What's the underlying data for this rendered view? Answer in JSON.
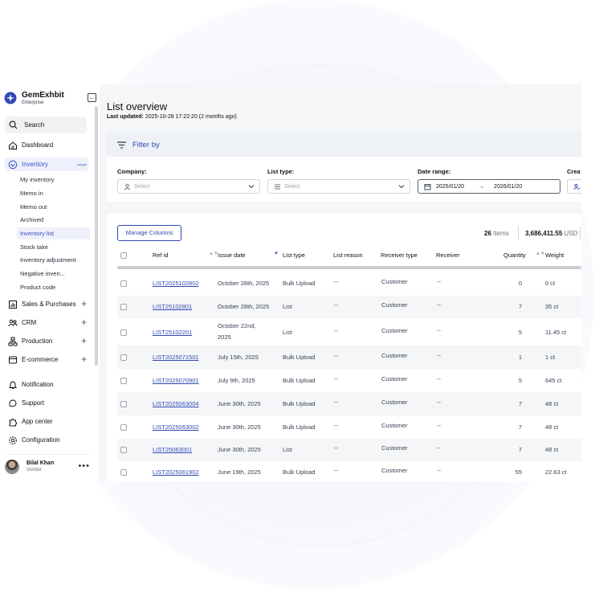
{
  "brand": {
    "name": "GemExhbit",
    "subtitle": "Enterprise"
  },
  "sidebar": {
    "search_label": "Search",
    "items": [
      {
        "label": "Dashboard",
        "icon": "home-icon"
      },
      {
        "label": "Inventory",
        "icon": "inventory-icon",
        "expanded": true
      },
      {
        "label": "Sales & Purchases",
        "icon": "chart-icon"
      },
      {
        "label": "CRM",
        "icon": "people-icon"
      },
      {
        "label": "Production",
        "icon": "production-icon"
      },
      {
        "label": "E-commerce",
        "icon": "cart-icon"
      },
      {
        "label": "Notification",
        "icon": "bell-icon"
      },
      {
        "label": "Support",
        "icon": "support-icon"
      },
      {
        "label": "App center",
        "icon": "puzzle-icon"
      },
      {
        "label": "Configuration",
        "icon": "gear-icon"
      }
    ],
    "inventory_sub": [
      "My inventory",
      "Memo in",
      "Memo out",
      "Archived",
      "Inventory list",
      "Stock take",
      "Inventory adjustment",
      "Negative inven...",
      "Product code"
    ],
    "active_sub": "Inventory list",
    "user": {
      "name": "Bilal Khan",
      "role": "Vendor"
    }
  },
  "main": {
    "title": "List overview",
    "last_updated_label": "Last updated:",
    "last_updated_value": "2025-10-28 17:22:20 (2 months ago)",
    "filter_label": "Filter by",
    "filters": {
      "company_label": "Company:",
      "company_placeholder": "Select",
      "list_type_label": "List type:",
      "list_type_placeholder": "Select",
      "date_range_label": "Date range:",
      "date_from": "2025/01/20",
      "date_to": "2026/01/20",
      "created_label": "Crea"
    },
    "manage_columns": "Manage Columns",
    "items_count": "26",
    "items_label": "Items",
    "total_value": "3,686,411.55",
    "total_currency": "USD",
    "columns": [
      "Ref id",
      "Issue date",
      "List type",
      "List reason",
      "Receiver type",
      "Receiver",
      "Quantity",
      "Weight"
    ],
    "rows": [
      {
        "ref": "LIST2025102802",
        "date": "October 28th, 2025",
        "type": "Bulk Upload",
        "reason": "--",
        "receiver_type": "Customer",
        "receiver": "--",
        "qty": "0",
        "weight": "0 ct"
      },
      {
        "ref": "LIST25102801",
        "date": "October 28th, 2025",
        "type": "List",
        "reason": "--",
        "receiver_type": "Customer",
        "receiver": "--",
        "qty": "7",
        "weight": "35 ct"
      },
      {
        "ref": "LIST25102201",
        "date": "October 22nd,",
        "date2": "2025",
        "type": "List",
        "reason": "--",
        "receiver_type": "Customer",
        "receiver": "--",
        "qty": "5",
        "weight": "11.45 ct"
      },
      {
        "ref": "LIST2025071501",
        "date": "July 15th, 2025",
        "type": "Bulk Upload",
        "reason": "--",
        "receiver_type": "Customer",
        "receiver": "--",
        "qty": "1",
        "weight": "1 ct"
      },
      {
        "ref": "LIST2025070901",
        "date": "July 9th, 2025",
        "type": "Bulk Upload",
        "reason": "--",
        "receiver_type": "Customer",
        "receiver": "--",
        "qty": "5",
        "weight": "645 ct"
      },
      {
        "ref": "LIST2025063004",
        "date": "June 30th, 2025",
        "type": "Bulk Upload",
        "reason": "--",
        "receiver_type": "Customer",
        "receiver": "--",
        "qty": "7",
        "weight": "48 ct"
      },
      {
        "ref": "LIST2025063002",
        "date": "June 30th, 2025",
        "type": "Bulk Upload",
        "reason": "--",
        "receiver_type": "Customer",
        "receiver": "--",
        "qty": "7",
        "weight": "48 ct"
      },
      {
        "ref": "LIST25063001",
        "date": "June 30th, 2025",
        "type": "List",
        "reason": "--",
        "receiver_type": "Customer",
        "receiver": "--",
        "qty": "7",
        "weight": "48 ct"
      },
      {
        "ref": "LIST2025061902",
        "date": "June 19th, 2025",
        "type": "Bulk Upload",
        "reason": "--",
        "receiver_type": "Customer",
        "receiver": "--",
        "qty": "55",
        "weight": "22.63 ct"
      }
    ]
  },
  "colors": {
    "accent": "#2f4ab5",
    "active_bg": "#eef0fb",
    "panel_bg": "#f5f6f8"
  }
}
